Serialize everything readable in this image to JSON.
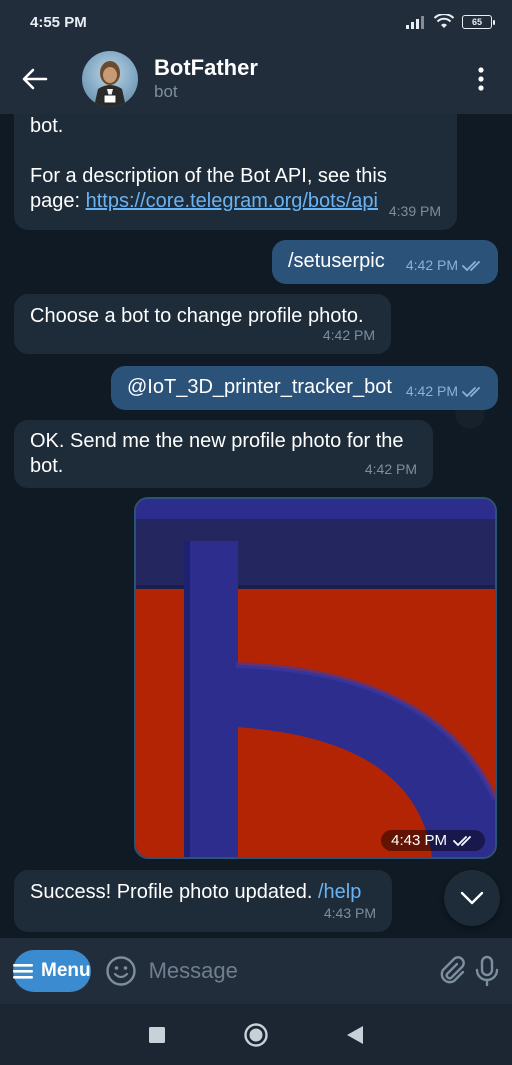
{
  "status_bar": {
    "time": "4:55 PM",
    "battery": "65"
  },
  "header": {
    "title": "BotFather",
    "subtitle": "bot"
  },
  "messages": {
    "m1_partial": "bot.",
    "m1_text": "For a description of the Bot API, see this page: ",
    "m1_link": "https://core.telegram.org/bots/api",
    "m1_time": "4:39 PM",
    "m2_text": "/setuserpic",
    "m2_time": "4:42 PM",
    "m3_text": "Choose a bot to change profile photo.",
    "m3_time": "4:42 PM",
    "m4_text": "@IoT_3D_printer_tracker_bot",
    "m4_time": "4:42 PM",
    "m5_text": "OK. Send me the new profile photo for the bot.",
    "m5_time": "4:42 PM",
    "m6_time": "4:43 PM",
    "m7_text": "Success! Profile photo updated. ",
    "m7_cmd": "/help",
    "m7_time": "4:43 PM"
  },
  "input_bar": {
    "menu_label": "Menu",
    "placeholder": "Message"
  },
  "colors": {
    "accent": "#3a8bd0",
    "link": "#6ab3f3",
    "incoming_bubble": "#1e2c3a",
    "outgoing_bubble": "#2b5278",
    "photo_red": "#b32405",
    "photo_blue": "#2c2d8c"
  },
  "icons": [
    "back-arrow",
    "more-vertical",
    "double-check",
    "chevron-down",
    "emoji",
    "paperclip",
    "microphone",
    "nav-square",
    "nav-circle",
    "nav-triangle"
  ]
}
